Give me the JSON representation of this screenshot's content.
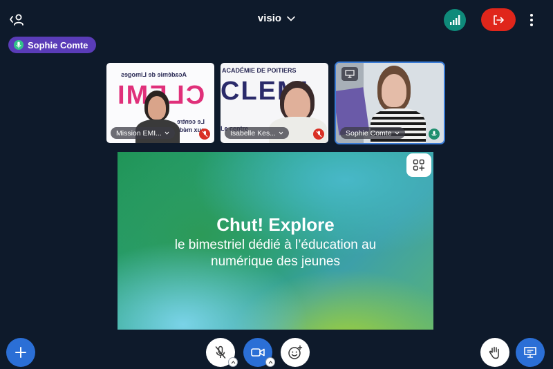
{
  "header": {
    "room_title": "visio",
    "users_icon": "users-toggle-icon",
    "connection_icon": "signal-bars-icon",
    "leave_icon": "leave-door-icon",
    "more_icon": "vertical-dots-icon"
  },
  "active_speaker": {
    "name": "Sophie Comte",
    "icon": "microphone-icon"
  },
  "tiles": [
    {
      "name": "Mission EMI...",
      "mic": "muted",
      "logo_lines": [
        "Académie de Limoges"
      ],
      "logo": "CLEMI",
      "caption_lines": [
        "Le centre",
        "aux médi"
      ]
    },
    {
      "name": "Isabelle Kes...",
      "mic": "muted",
      "logo_lines": [
        "ACADÉMIE DE POITIERS"
      ],
      "logo": "CLEMI",
      "caption_lines": [
        "Le centre"
      ]
    },
    {
      "name": "Sophie Comte",
      "mic": "live",
      "presenter": true
    }
  ],
  "presentation": {
    "title": "Chut! Explore",
    "subtitle": "le bimestriel dédié à l’éducation au numérique des jeunes"
  },
  "controls": {
    "add": "plus-icon",
    "mic": "microphone-off-icon",
    "camera": "video-camera-icon",
    "reactions": "smiley-plus-icon",
    "raise_hand": "raise-hand-icon",
    "screen_share": "presentation-screen-icon",
    "layout": "layout-grid-icon"
  },
  "colors": {
    "background": "#0e1a2b",
    "accent_blue": "#2b6fd6",
    "leave_red": "#e0261b",
    "speaker_purple": "#5a3cb8",
    "connection_teal": "#0f8a7a"
  }
}
